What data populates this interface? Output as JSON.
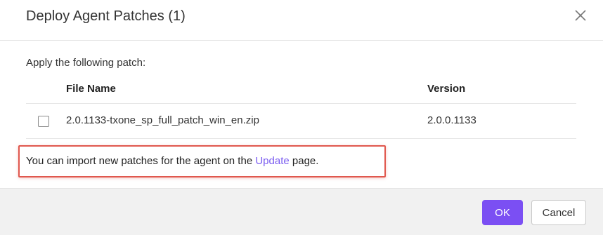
{
  "dialog": {
    "title": "Deploy Agent Patches (1)",
    "close_icon": "close-icon"
  },
  "content": {
    "intro": "Apply the following patch:",
    "table": {
      "columns": [
        "File Name",
        "Version"
      ],
      "rows": [
        {
          "checked": false,
          "file_name": "2.0.1133-txone_sp_full_patch_win_en.zip",
          "version": "2.0.0.1133"
        }
      ]
    },
    "note": {
      "before": "You can import new patches for the agent on the ",
      "link": "Update",
      "after": " page."
    }
  },
  "footer": {
    "ok_label": "OK",
    "cancel_label": "Cancel"
  },
  "colors": {
    "accent": "#7b4ff3",
    "link": "#7a5cf0",
    "highlight_border": "#e0584e",
    "footer_bg": "#f1f1f1"
  }
}
